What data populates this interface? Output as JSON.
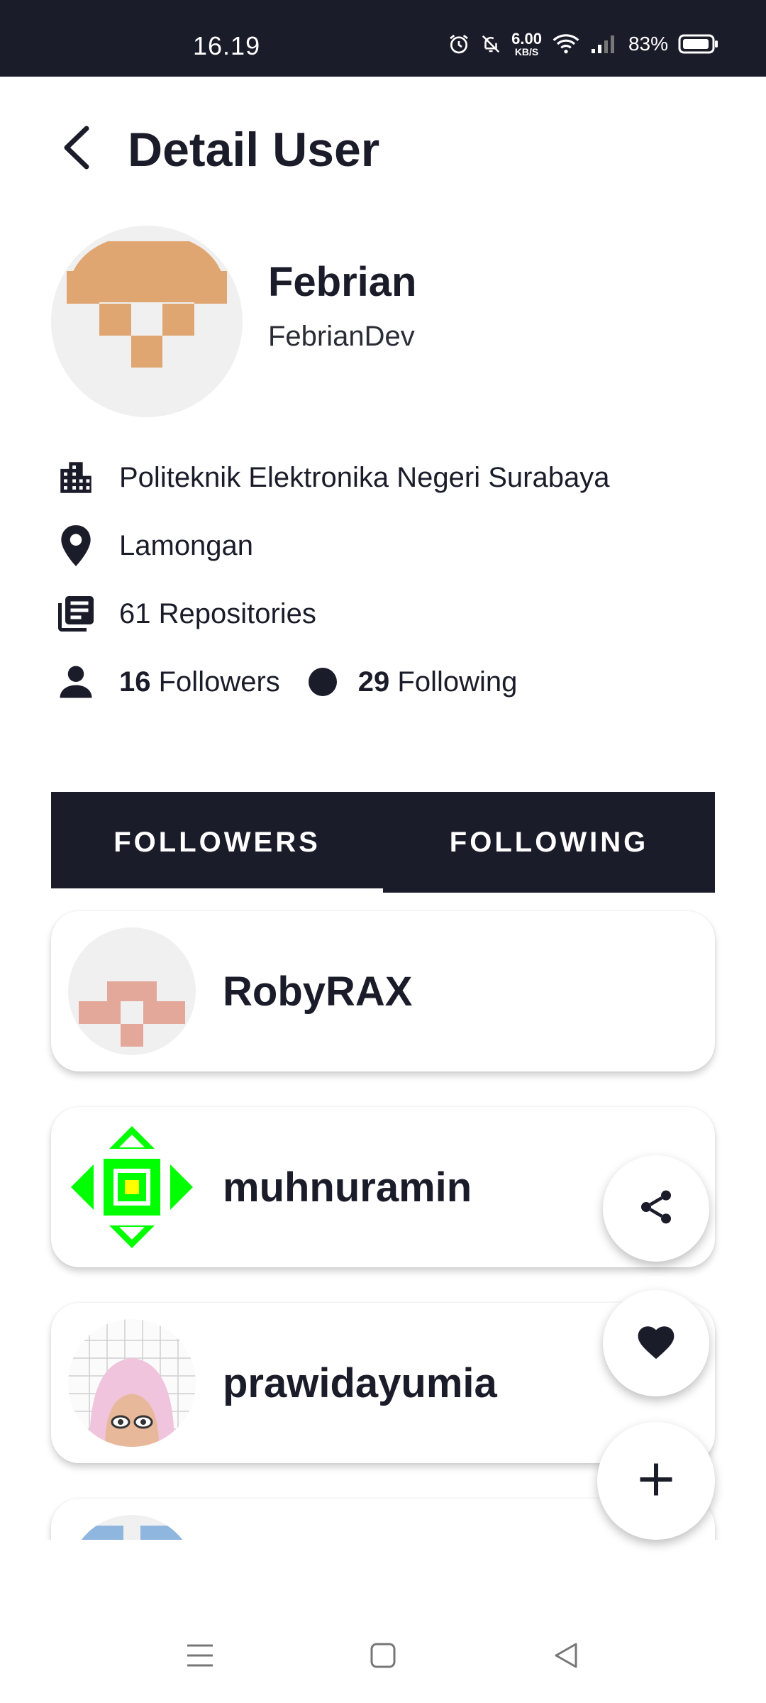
{
  "status_bar": {
    "time": "16.19",
    "speed_value": "6.00",
    "speed_unit": "KB/S",
    "battery": "83%",
    "icons": [
      "alarm-icon",
      "bell-off-icon",
      "wifi-icon",
      "signal-icon",
      "battery-icon"
    ]
  },
  "header": {
    "title": "Detail User",
    "back_icon": "back-arrow-icon"
  },
  "profile": {
    "name": "Febrian",
    "login": "FebrianDev",
    "company": "Politeknik Elektronika Negeri Surabaya",
    "location": "Lamongan",
    "repositories": "61 Repositories",
    "followers_count": "16",
    "followers_label": "Followers",
    "following_count": "29",
    "following_label": "Following",
    "avatar_color": "#e0a672"
  },
  "tabs": [
    {
      "label": "FOLLOWERS",
      "active": true
    },
    {
      "label": "FOLLOWING",
      "active": false
    }
  ],
  "list": [
    {
      "login": "RobyRAX",
      "avatar_color": "#e3a89a"
    },
    {
      "login": "muhnuramin",
      "avatar_color": "#00ff00"
    },
    {
      "login": "prawidayumia",
      "avatar_color": "#f0c4dc"
    },
    {
      "login": "",
      "avatar_color": "#8fb6df"
    }
  ],
  "fabs": [
    {
      "icon": "share-icon"
    },
    {
      "icon": "heart-icon"
    },
    {
      "icon": "plus-icon"
    }
  ],
  "nav": [
    "menu-icon",
    "home-square-icon",
    "back-triangle-icon"
  ],
  "colors": {
    "primary": "#1b1c2a",
    "background": "#ffffff"
  }
}
